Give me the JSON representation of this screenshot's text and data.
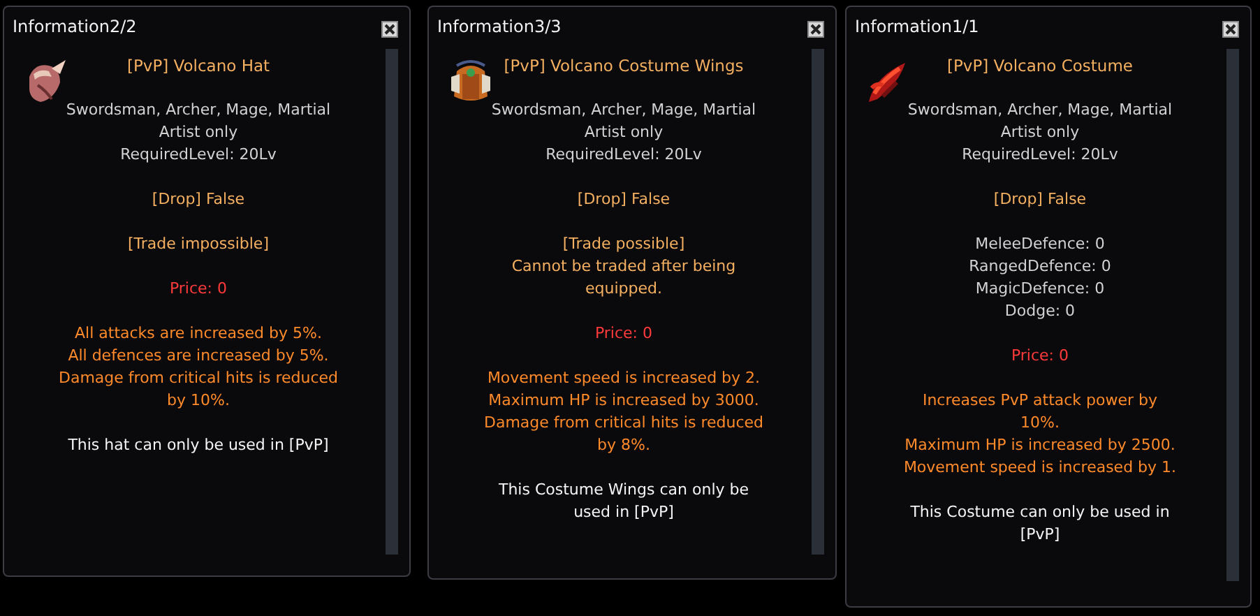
{
  "windows": [
    {
      "title": "Information2/2",
      "item_name": "[PvP] Volcano Hat",
      "sections": [
        {
          "kind": "classes",
          "lines": [
            "Swordsman, Archer, Mage, Martial\nArtist only",
            "RequiredLevel: 20Lv"
          ]
        },
        {
          "kind": "flag",
          "lines": [
            "[Drop] False"
          ]
        },
        {
          "kind": "flag",
          "lines": [
            "[Trade impossible]"
          ]
        },
        {
          "kind": "price",
          "lines": [
            "Price: 0"
          ]
        },
        {
          "kind": "effect",
          "lines": [
            "All attacks are increased by 5%.",
            "All defences are increased by 5%.",
            "Damage from critical hits is reduced\nby 10%."
          ]
        },
        {
          "kind": "usage",
          "lines": [
            "This hat can only be used in [PvP]"
          ]
        }
      ]
    },
    {
      "title": "Information3/3",
      "item_name": "[PvP] Volcano Costume Wings",
      "sections": [
        {
          "kind": "classes",
          "lines": [
            "Swordsman, Archer, Mage, Martial\nArtist only",
            "RequiredLevel: 20Lv"
          ]
        },
        {
          "kind": "flag",
          "lines": [
            "[Drop] False"
          ]
        },
        {
          "kind": "flag",
          "lines": [
            "[Trade possible]",
            "Cannot be traded after being\nequipped."
          ]
        },
        {
          "kind": "price",
          "lines": [
            "Price: 0"
          ]
        },
        {
          "kind": "effect",
          "lines": [
            "Movement speed is increased by 2.",
            "Maximum HP is increased by 3000.",
            "Damage from critical hits is reduced\nby 8%."
          ]
        },
        {
          "kind": "usage",
          "lines": [
            "This Costume Wings can only be\nused in [PvP]"
          ]
        }
      ]
    },
    {
      "title": "Information1/1",
      "item_name": "[PvP] Volcano Costume",
      "sections": [
        {
          "kind": "classes",
          "lines": [
            "Swordsman, Archer, Mage, Martial\nArtist only",
            "RequiredLevel: 20Lv"
          ]
        },
        {
          "kind": "flag",
          "lines": [
            "[Drop] False"
          ]
        },
        {
          "kind": "classes",
          "lines": [
            "MeleeDefence: 0",
            "RangedDefence: 0",
            "MagicDefence: 0",
            "Dodge: 0"
          ]
        },
        {
          "kind": "price",
          "lines": [
            "Price: 0"
          ]
        },
        {
          "kind": "effect",
          "lines": [
            "Increases PvP attack power by\n10%.",
            "Maximum HP is increased by 2500.",
            "Movement speed is increased by 1."
          ]
        },
        {
          "kind": "usage",
          "lines": [
            "This Costume can only be used in\n[PvP]"
          ]
        }
      ]
    }
  ]
}
